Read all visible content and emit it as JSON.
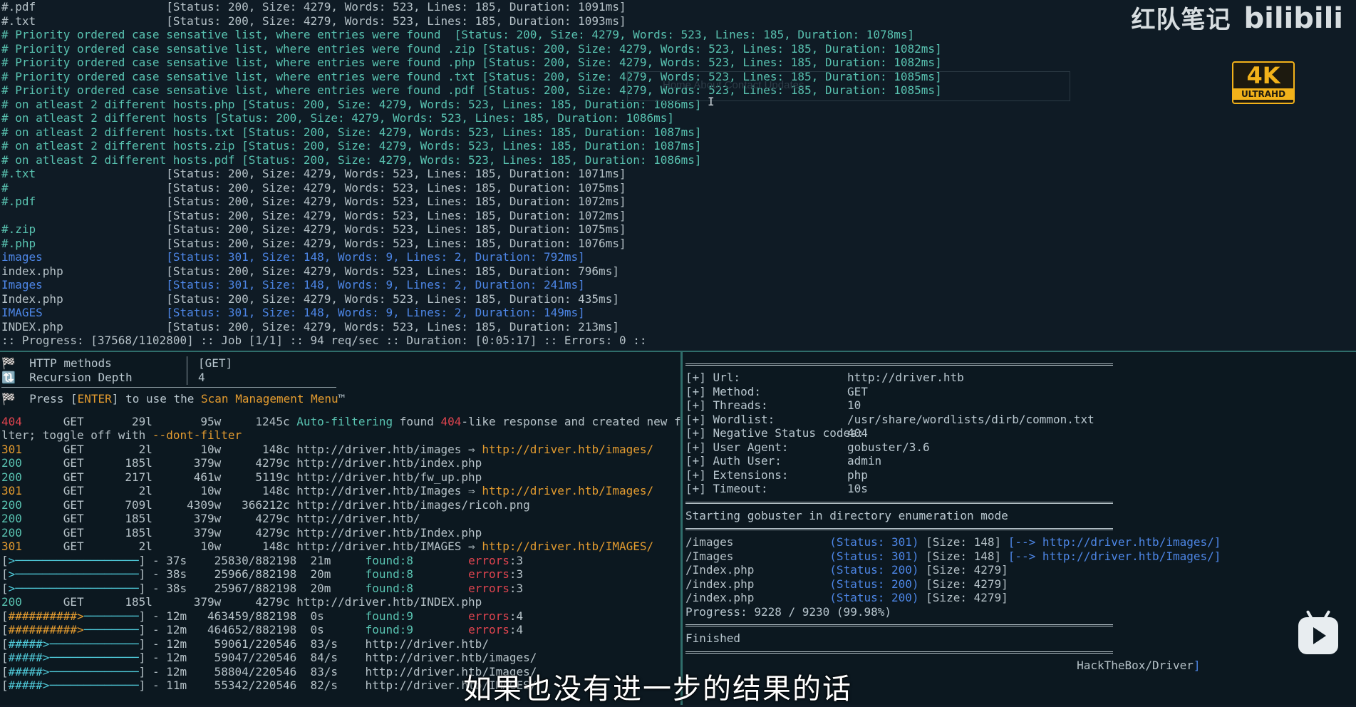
{
  "top_lines": [
    [
      [
        "gray",
        "#.pdf                   [Status: 200, Size: 4279, Words: 523, Lines: 185, Duration: 1091ms]"
      ]
    ],
    [
      [
        "gray",
        "#.txt                   [Status: 200, Size: 4279, Words: 523, Lines: 185, Duration: 1093ms]"
      ]
    ],
    [
      [
        "teal",
        "# Priority ordered case sensative list, where entries were found  [Status: 200, Size: 4279, Words: 523, Lines: 185, Duration: 1078ms]"
      ]
    ],
    [
      [
        "teal",
        "# Priority ordered case sensative list, where entries were found .zip [Status: 200, Size: 4279, Words: 523, Lines: 185, Duration: 1082ms]"
      ]
    ],
    [
      [
        "teal",
        "# Priority ordered case sensative list, where entries were found .php [Status: 200, Size: 4279, Words: 523, Lines: 185, Duration: 1082ms]"
      ]
    ],
    [
      [
        "teal",
        "# Priority ordered case sensative list, where entries were found .txt [Status: 200, Size: 4279, Words: 523, Lines: 185, Duration: 1085ms]"
      ]
    ],
    [
      [
        "teal",
        "# Priority ordered case sensative list, where entries were found .pdf [Status: 200, Size: 4279, Words: 523, Lines: 185, Duration: 1085ms]"
      ]
    ],
    [
      [
        "teal",
        "# on atleast 2 different hosts.php [Status: 200, Size: 4279, Words: 523, Lines: 185, Duration: 1086ms]"
      ]
    ],
    [
      [
        "teal",
        "# on atleast 2 different hosts [Status: 200, Size: 4279, Words: 523, Lines: 185, Duration: 1086ms]"
      ]
    ],
    [
      [
        "teal",
        "# on atleast 2 different hosts.txt [Status: 200, Size: 4279, Words: 523, Lines: 185, Duration: 1087ms]"
      ]
    ],
    [
      [
        "teal",
        "# on atleast 2 different hosts.zip [Status: 200, Size: 4279, Words: 523, Lines: 185, Duration: 1087ms]"
      ]
    ],
    [
      [
        "teal",
        "# on atleast 2 different hosts.pdf [Status: 200, Size: 4279, Words: 523, Lines: 185, Duration: 1086ms]"
      ]
    ],
    [
      [
        "teal",
        "#.txt                   "
      ],
      [
        "gray",
        "[Status: 200, Size: 4279, Words: 523, Lines: 185, Duration: 1071ms]"
      ]
    ],
    [
      [
        "teal",
        "#                       "
      ],
      [
        "gray",
        "[Status: 200, Size: 4279, Words: 523, Lines: 185, Duration: 1075ms]"
      ]
    ],
    [
      [
        "teal",
        "#.pdf                   "
      ],
      [
        "gray",
        "[Status: 200, Size: 4279, Words: 523, Lines: 185, Duration: 1072ms]"
      ]
    ],
    [
      [
        "gray",
        "                        [Status: 200, Size: 4279, Words: 523, Lines: 185, Duration: 1072ms]"
      ]
    ],
    [
      [
        "teal",
        "#.zip                   "
      ],
      [
        "gray",
        "[Status: 200, Size: 4279, Words: 523, Lines: 185, Duration: 1075ms]"
      ]
    ],
    [
      [
        "teal",
        "#.php                   "
      ],
      [
        "gray",
        "[Status: 200, Size: 4279, Words: 523, Lines: 185, Duration: 1076ms]"
      ]
    ],
    [
      [
        "blue",
        "images                  [Status: 301, Size: 148, Words: 9, Lines: 2, Duration: 792ms]"
      ]
    ],
    [
      [
        "gray",
        "index.php               [Status: 200, Size: 4279, Words: 523, Lines: 185, Duration: 796ms]"
      ]
    ],
    [
      [
        "blue",
        "Images                  [Status: 301, Size: 148, Words: 9, Lines: 2, Duration: 241ms]"
      ]
    ],
    [
      [
        "gray",
        "Index.php               [Status: 200, Size: 4279, Words: 523, Lines: 185, Duration: 435ms]"
      ]
    ],
    [
      [
        "blue",
        "IMAGES                  [Status: 301, Size: 148, Words: 9, Lines: 2, Duration: 149ms]"
      ]
    ],
    [
      [
        "gray",
        "INDEX.php               [Status: 200, Size: 4279, Words: 523, Lines: 185, Duration: 213ms]"
      ]
    ],
    [
      [
        "gray",
        ":: Progress: [37568/1102800] :: Job [1/1] :: 94 req/sec :: Duration: [0:05:17] :: Errors: 0 ::"
      ]
    ]
  ],
  "left_header": {
    "http_methods_label": "HTTP methods",
    "http_methods_value": "[GET]",
    "recursion_label": "Recursion Depth",
    "recursion_value": "4",
    "press_prefix": "Press [",
    "press_key": "ENTER",
    "press_mid": "] to use the ",
    "press_menu": "Scan Management Menu",
    "press_suffix": "™"
  },
  "left_lines": [
    [
      [
        "red",
        "404"
      ],
      [
        "gray",
        "      GET       29l       95w     1245c "
      ],
      [
        "teal",
        "Auto-filtering"
      ],
      [
        "gray",
        " found "
      ],
      [
        "red",
        "404"
      ],
      [
        "gray",
        "-like response and created new fi"
      ]
    ],
    [
      [
        "gray",
        "lter; toggle off with "
      ],
      [
        "orange",
        "--dont-filter"
      ]
    ],
    [
      [
        "orange",
        "301"
      ],
      [
        "gray",
        "      GET        2l       10w      148c http://driver.htb/images ⇒ "
      ],
      [
        "orange",
        "http://driver.htb/images/"
      ]
    ],
    [
      [
        "teal",
        "200"
      ],
      [
        "gray",
        "      GET      185l      379w     4279c http://driver.htb/index.php"
      ]
    ],
    [
      [
        "teal",
        "200"
      ],
      [
        "gray",
        "      GET      217l      461w     5119c http://driver.htb/fw_up.php"
      ]
    ],
    [
      [
        "orange",
        "301"
      ],
      [
        "gray",
        "      GET        2l       10w      148c http://driver.htb/Images ⇒ "
      ],
      [
        "orange",
        "http://driver.htb/Images/"
      ]
    ],
    [
      [
        "teal",
        "200"
      ],
      [
        "gray",
        "      GET      709l     4309w   366212c http://driver.htb/images/ricoh.png"
      ]
    ],
    [
      [
        "teal",
        "200"
      ],
      [
        "gray",
        "      GET      185l      379w     4279c http://driver.htb/"
      ]
    ],
    [
      [
        "teal",
        "200"
      ],
      [
        "gray",
        "      GET      185l      379w     4279c http://driver.htb/Index.php"
      ]
    ],
    [
      [
        "orange",
        "301"
      ],
      [
        "gray",
        "      GET        2l       10w      148c http://driver.htb/IMAGES ⇒ "
      ],
      [
        "orange",
        "http://driver.htb/IMAGES/"
      ]
    ],
    [
      [
        "gray",
        "["
      ],
      [
        "cyan",
        ">──────────────────"
      ],
      [
        "gray",
        "] - 37s    25830/882198  21m     "
      ],
      [
        "green",
        "found:8"
      ],
      [
        "gray",
        "        "
      ],
      [
        "red",
        "errors"
      ],
      [
        "gray",
        ":3"
      ]
    ],
    [
      [
        "gray",
        "["
      ],
      [
        "cyan",
        ">──────────────────"
      ],
      [
        "gray",
        "] - 38s    25966/882198  20m     "
      ],
      [
        "green",
        "found:8"
      ],
      [
        "gray",
        "        "
      ],
      [
        "red",
        "errors"
      ],
      [
        "gray",
        ":3"
      ]
    ],
    [
      [
        "gray",
        "["
      ],
      [
        "cyan",
        ">──────────────────"
      ],
      [
        "gray",
        "] - 38s    25967/882198  20m     "
      ],
      [
        "green",
        "found:8"
      ],
      [
        "gray",
        "        "
      ],
      [
        "red",
        "errors"
      ],
      [
        "gray",
        ":3"
      ]
    ],
    [
      [
        "teal",
        "200"
      ],
      [
        "gray",
        "      GET      185l      379w     4279c http://driver.htb/INDEX.php"
      ]
    ],
    [
      [
        "gray",
        "["
      ],
      [
        "orange",
        "##########>"
      ],
      [
        "cyan",
        "────────"
      ],
      [
        "gray",
        "] - 12m   463459/882198  0s      "
      ],
      [
        "green",
        "found:9"
      ],
      [
        "gray",
        "        "
      ],
      [
        "red",
        "errors"
      ],
      [
        "gray",
        ":4"
      ]
    ],
    [
      [
        "gray",
        "["
      ],
      [
        "orange",
        "##########>"
      ],
      [
        "cyan",
        "────────"
      ],
      [
        "gray",
        "] - 12m   464652/882198  0s      "
      ],
      [
        "green",
        "found:9"
      ],
      [
        "gray",
        "        "
      ],
      [
        "red",
        "errors"
      ],
      [
        "gray",
        ":4"
      ]
    ],
    [
      [
        "gray",
        "["
      ],
      [
        "cyan",
        "#####>─────────────"
      ],
      [
        "gray",
        "] - 12m    59061/220546  83/s    http://driver.htb/"
      ]
    ],
    [
      [
        "gray",
        "["
      ],
      [
        "cyan",
        "#####>─────────────"
      ],
      [
        "gray",
        "] - 12m    59047/220546  84/s    http://driver.htb/images/"
      ]
    ],
    [
      [
        "gray",
        "["
      ],
      [
        "cyan",
        "#####>─────────────"
      ],
      [
        "gray",
        "] - 12m    58804/220546  83/s    http://driver.htb/Images/"
      ]
    ],
    [
      [
        "gray",
        "["
      ],
      [
        "cyan",
        "#####>─────────────"
      ],
      [
        "gray",
        "] - 11m    55342/220546  82/s    http://driver.htb/IMAGES/"
      ]
    ]
  ],
  "right_config": [
    [
      "[+] Url:",
      "http://driver.htb"
    ],
    [
      "[+] Method:",
      "GET"
    ],
    [
      "[+] Threads:",
      "10"
    ],
    [
      "[+] Wordlist:",
      "/usr/share/wordlists/dirb/common.txt"
    ],
    [
      "[+] Negative Status codes:",
      "404"
    ],
    [
      "[+] User Agent:",
      "gobuster/3.6"
    ],
    [
      "[+] Auth User:",
      "admin"
    ],
    [
      "[+] Extensions:",
      "php"
    ],
    [
      "[+] Timeout:",
      "10s"
    ]
  ],
  "right_start": "Starting gobuster in directory enumeration mode",
  "right_results": [
    [
      [
        "gray",
        "/images              "
      ],
      [
        "blue",
        "(Status: 301)"
      ],
      [
        "gray",
        " [Size: 148] "
      ],
      [
        "blue",
        "[--> http://driver.htb/images/]"
      ]
    ],
    [
      [
        "gray",
        "/Images              "
      ],
      [
        "blue",
        "(Status: 301)"
      ],
      [
        "gray",
        " [Size: 148] "
      ],
      [
        "blue",
        "[--> http://driver.htb/Images/]"
      ]
    ],
    [
      [
        "gray",
        "/Index.php           "
      ],
      [
        "blue",
        "(Status: 200)"
      ],
      [
        "gray",
        " [Size: 4279]"
      ]
    ],
    [
      [
        "gray",
        "/index.php           "
      ],
      [
        "blue",
        "(Status: 200)"
      ],
      [
        "gray",
        " [Size: 4279]"
      ]
    ],
    [
      [
        "gray",
        "/index.php           "
      ],
      [
        "blue",
        "(Status: 200)"
      ],
      [
        "gray",
        " [Size: 4279]"
      ]
    ]
  ],
  "right_progress": "Progress: 9228 / 9230 (99.98%)",
  "right_finished": "Finished",
  "right_prompt": "HackTheBox/Driver",
  "watermark": {
    "text": "红队笔记",
    "brand": "bilibili"
  },
  "badge_4k": {
    "top": "4K",
    "bottom": "ULTRAHD"
  },
  "subtitle": "如果也没有进一步的结果的话",
  "colors": {
    "teal": "#59c3b1",
    "blue": "#4d86e6",
    "red": "#e0444f",
    "orange": "#e39b2f",
    "bg": "#0f1a24",
    "divider": "#2f6d6a"
  }
}
